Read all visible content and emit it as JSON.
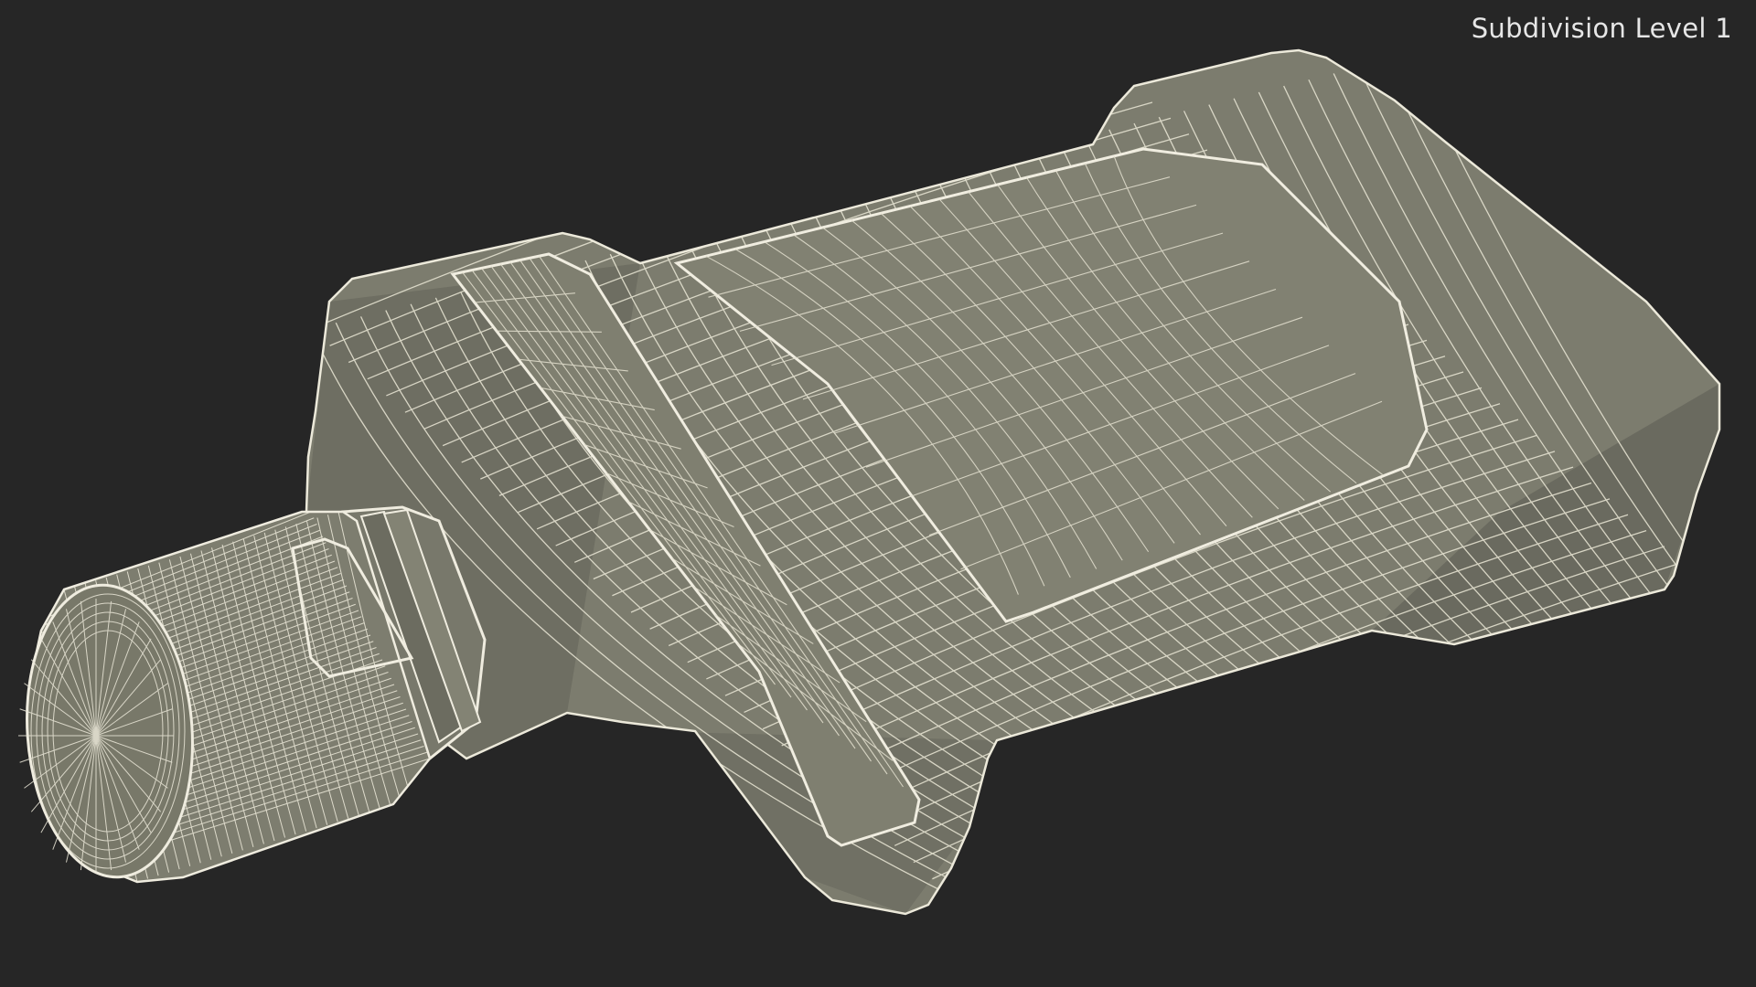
{
  "viewport": {
    "subdivision_label": "Subdivision Level 1",
    "colors": {
      "background": "#262626",
      "surface": "#7b7b6d",
      "surface_dark": "#65655a",
      "surface_light": "#8a8a7b",
      "wire": "#e9e6d6",
      "wire_dense": "#f3f1e4"
    },
    "model": {
      "type": "wireframe-mesh",
      "icon": "cylindrical-device-model"
    }
  }
}
